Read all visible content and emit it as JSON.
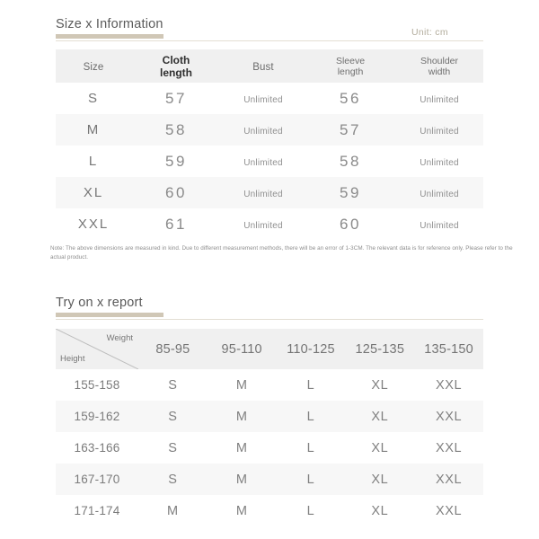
{
  "sections": {
    "size": {
      "title": "Size x Information",
      "unit": "Unit: cm",
      "headers": {
        "size": "Size",
        "cloth_length": "Cloth\nlength",
        "cloth_length_l1": "Cloth",
        "cloth_length_l2": "length",
        "bust": "Bust",
        "sleeve_length_l1": "Sleeve",
        "sleeve_length_l2": "length",
        "shoulder_width_l1": "Shoulder",
        "shoulder_width_l2": "width"
      },
      "rows": [
        {
          "size": "S",
          "cloth_length": "57",
          "bust": "Unlimited",
          "sleeve_length": "56",
          "shoulder_width": "Unlimited"
        },
        {
          "size": "M",
          "cloth_length": "58",
          "bust": "Unlimited",
          "sleeve_length": "57",
          "shoulder_width": "Unlimited"
        },
        {
          "size": "L",
          "cloth_length": "59",
          "bust": "Unlimited",
          "sleeve_length": "58",
          "shoulder_width": "Unlimited"
        },
        {
          "size": "XL",
          "cloth_length": "60",
          "bust": "Unlimited",
          "sleeve_length": "59",
          "shoulder_width": "Unlimited"
        },
        {
          "size": "XXL",
          "cloth_length": "61",
          "bust": "Unlimited",
          "sleeve_length": "60",
          "shoulder_width": "Unlimited"
        }
      ],
      "note": "Note: The above dimensions are measured in kind. Due to different measurement methods, there will be an error of 1-3CM. The relevant data is for reference only. Please refer to the actual product."
    },
    "tryon": {
      "title": "Try on x report",
      "corner": {
        "weight_label": "Weight",
        "height_label": "Height"
      },
      "weight_columns": [
        "85-95",
        "95-110",
        "110-125",
        "125-135",
        "135-150"
      ],
      "rows": [
        {
          "height": "155-158",
          "sizes": [
            "S",
            "M",
            "L",
            "XL",
            "XXL"
          ]
        },
        {
          "height": "159-162",
          "sizes": [
            "S",
            "M",
            "L",
            "XL",
            "XXL"
          ]
        },
        {
          "height": "163-166",
          "sizes": [
            "S",
            "M",
            "L",
            "XL",
            "XXL"
          ]
        },
        {
          "height": "167-170",
          "sizes": [
            "S",
            "M",
            "L",
            "XL",
            "XXL"
          ]
        },
        {
          "height": "171-174",
          "sizes": [
            "M",
            "M",
            "L",
            "XL",
            "XXL"
          ]
        }
      ]
    }
  },
  "colors": {
    "accent_underline": "#cdc4b2",
    "header_bg": "#f0f0f0",
    "stripe_bg": "#f7f7f7",
    "text": "#6f6f6f",
    "unit_text": "#b3ad9d"
  }
}
